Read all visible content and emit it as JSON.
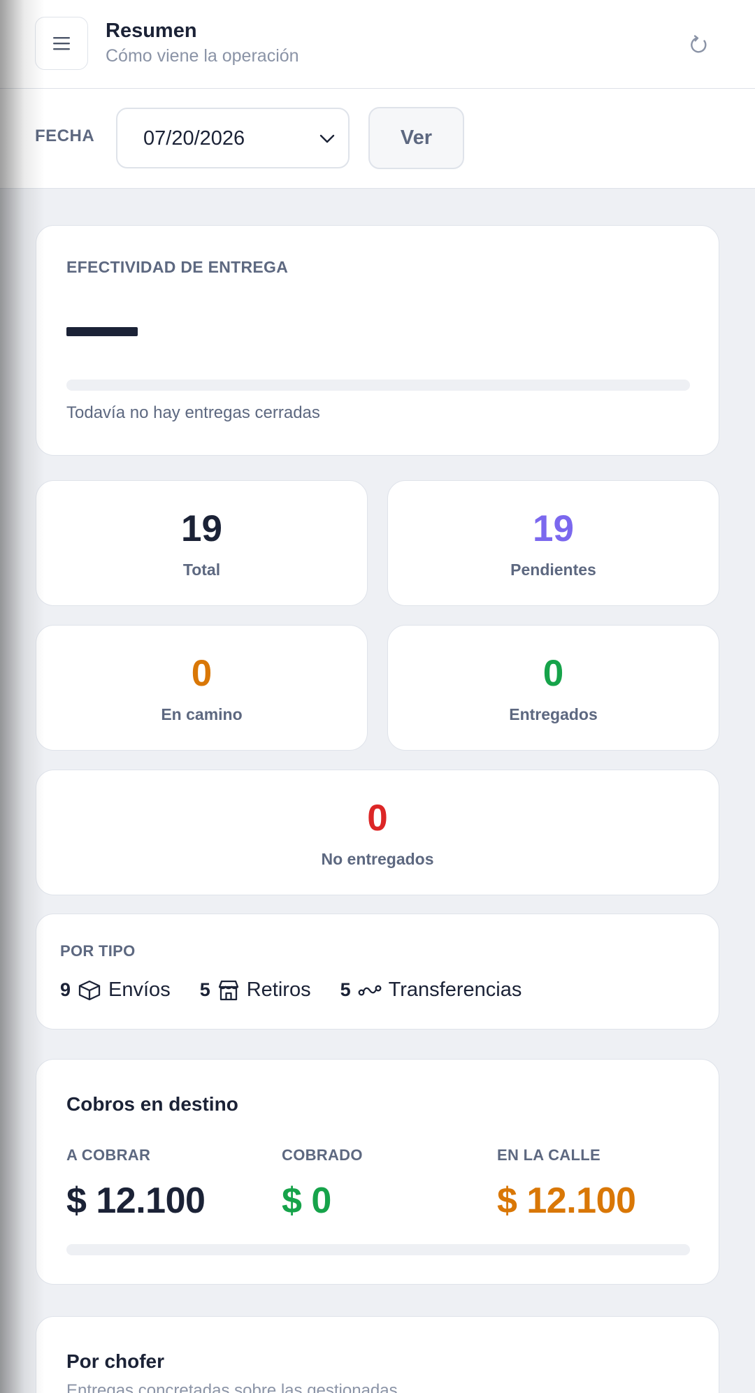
{
  "header": {
    "title": "Resumen",
    "subtitle": "Cómo viene la operación"
  },
  "filter": {
    "label": "FECHA",
    "date_value": "07/20/2026",
    "view_button": "Ver"
  },
  "effectiveness": {
    "label": "EFECTIVIDAD DE ENTREGA",
    "value": "—",
    "progress_fraction": 0,
    "note": "Todavía no hay entregas cerradas"
  },
  "stats": {
    "total": {
      "value": "19",
      "label": "Total",
      "color": "#1b2236"
    },
    "pendientes": {
      "value": "19",
      "label": "Pendientes",
      "color": "#7b68ee"
    },
    "en_camino": {
      "value": "0",
      "label": "En camino",
      "color": "#d97706"
    },
    "entregados": {
      "value": "0",
      "label": "Entregados",
      "color": "#16a34a"
    },
    "no_entregados": {
      "value": "0",
      "label": "No entregados",
      "color": "#dc2626"
    }
  },
  "by_type": {
    "label": "POR TIPO",
    "items": [
      {
        "count": "9",
        "icon": "box-icon",
        "name": "Envíos"
      },
      {
        "count": "5",
        "icon": "store-icon",
        "name": "Retiros"
      },
      {
        "count": "5",
        "icon": "transfer-icon",
        "name": "Transferencias"
      }
    ]
  },
  "cobros": {
    "title": "Cobros en destino",
    "a_cobrar": {
      "label": "A COBRAR",
      "value": "$ 12.100",
      "color": "#1b2236"
    },
    "cobrado": {
      "label": "COBRADO",
      "value": "$ 0",
      "color": "#16a34a"
    },
    "en_la_calle": {
      "label": "EN LA CALLE",
      "value": "$ 12.100",
      "color": "#d97706"
    },
    "progress_fraction": 0
  },
  "por_chofer": {
    "title": "Por chofer",
    "subtitle": "Entregas concretadas sobre las gestionadas"
  }
}
